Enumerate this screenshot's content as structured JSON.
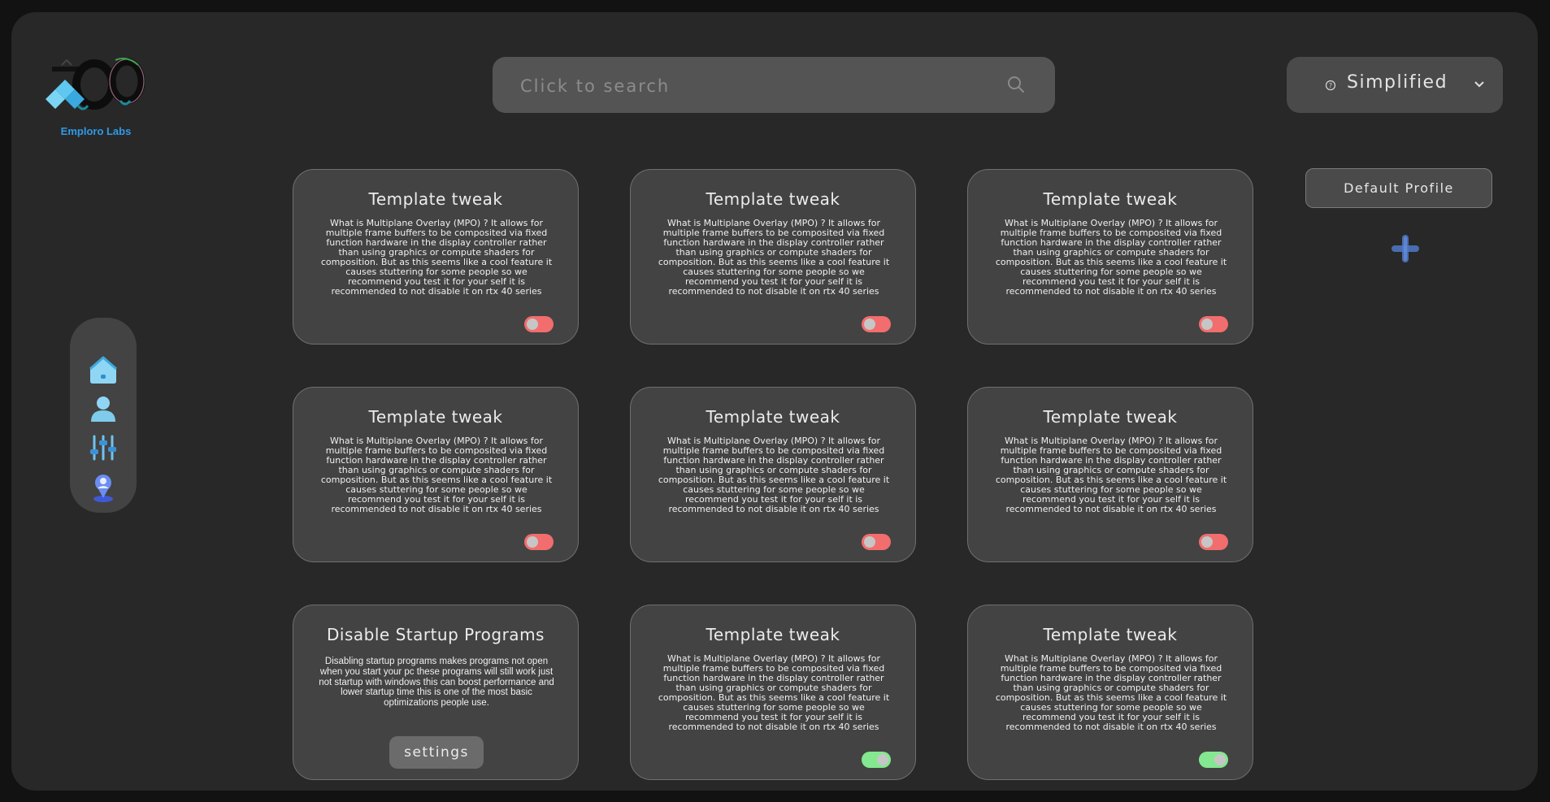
{
  "app": {
    "brand": "Emploro Labs"
  },
  "search": {
    "placeholder": "Click to search"
  },
  "mode_selector": {
    "value": "Simplified"
  },
  "sidebar": {
    "items": [
      {
        "icon": "home-icon"
      },
      {
        "icon": "user-icon"
      },
      {
        "icon": "sliders-icon"
      },
      {
        "icon": "user-pin-icon"
      }
    ]
  },
  "profiles": {
    "default_label": "Default Profile",
    "add_icon": "plus-icon"
  },
  "tweaks": [
    {
      "title": "Template tweak",
      "description": "What is Multiplane Overlay (MPO) ? It allows for multiple frame buffers to be composited via fixed function hardware in the display controller rather than using graphics or compute shaders for composition. But as this seems like a cool feature it causes stuttering for some people so we recommend you test it for your self it is recommended to not disable it on rtx 40 series",
      "enabled": false
    },
    {
      "title": "Template tweak",
      "description": "What is Multiplane Overlay (MPO) ? It allows for multiple frame buffers to be composited via fixed function hardware in the display controller rather than using graphics or compute shaders for composition. But as this seems like a cool feature it causes stuttering for some people so we recommend you test it for your self it is recommended to not disable it on rtx 40 series",
      "enabled": false
    },
    {
      "title": "Template tweak",
      "description": "What is Multiplane Overlay (MPO) ? It allows for multiple frame buffers to be composited via fixed function hardware in the display controller rather than using graphics or compute shaders for composition. But as this seems like a cool feature it causes stuttering for some people so we recommend you test it for your self it is recommended to not disable it on rtx 40 series",
      "enabled": false
    },
    {
      "title": "Template tweak",
      "description": "What is Multiplane Overlay (MPO) ? It allows for multiple frame buffers to be composited via fixed function hardware in the display controller rather than using graphics or compute shaders for composition. But as this seems like a cool feature it causes stuttering for some people so we recommend you test it for your self it is recommended to not disable it on rtx 40 series",
      "enabled": false
    },
    {
      "title": "Template tweak",
      "description": "What is Multiplane Overlay (MPO) ? It allows for multiple frame buffers to be composited via fixed function hardware in the display controller rather than using graphics or compute shaders for composition. But as this seems like a cool feature it causes stuttering for some people so we recommend you test it for your self it is recommended to not disable it on rtx 40 series",
      "enabled": false
    },
    {
      "title": "Template tweak",
      "description": "What is Multiplane Overlay (MPO) ? It allows for multiple frame buffers to be composited via fixed function hardware in the display controller rather than using graphics or compute shaders for composition. But as this seems like a cool feature it causes stuttering for some people so we recommend you test it for your self it is recommended to not disable it on rtx 40 series",
      "enabled": false
    },
    {
      "title": "Disable Startup Programs",
      "description": "Disabling startup programs makes programs not open when you start your pc these programs will still work just not startup with windows this can boost performance and lower startup time this is one of the most basic optimizations people use.",
      "button": "settings"
    },
    {
      "title": "Template tweak",
      "description": "What is Multiplane Overlay (MPO) ? It allows for multiple frame buffers to be composited via fixed function hardware in the display controller rather than using graphics or compute shaders for composition. But as this seems like a cool feature it causes stuttering for some people so we recommend you test it for your self it is recommended to not disable it on rtx 40 series",
      "enabled": true
    },
    {
      "title": "Template tweak",
      "description": "What is Multiplane Overlay (MPO) ? It allows for multiple frame buffers to be composited via fixed function hardware in the display controller rather than using graphics or compute shaders for composition. But as this seems like a cool feature it causes stuttering for some people so we recommend you test it for your self it is recommended to not disable it on rtx 40 series",
      "enabled": true
    }
  ],
  "colors": {
    "background": "#282828",
    "card": "#434343",
    "toggle_off": "#f26d6d",
    "toggle_on": "#83e88f",
    "brand_blue": "#2e9be6"
  }
}
